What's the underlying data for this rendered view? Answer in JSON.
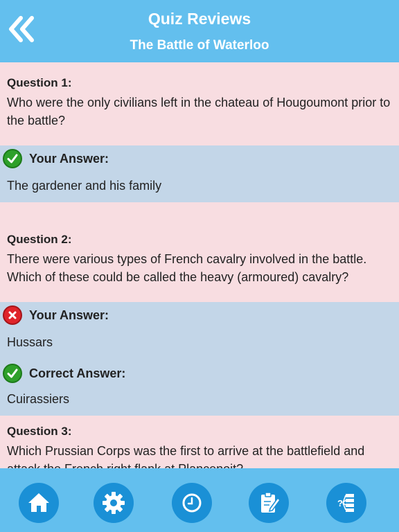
{
  "header": {
    "title": "Quiz Reviews",
    "subtitle": "The Battle of Waterloo"
  },
  "questions": [
    {
      "label": "Question 1:",
      "text": "Who were the only civilians left in the chateau of Hougoumont prior to the battle?",
      "your_answer_label": "Your Answer:",
      "your_answer": "The gardener and his family",
      "your_answer_status": "correct"
    },
    {
      "label": "Question 2:",
      "text": "There were various types of French cavalry involved in the battle. Which of these could be called the heavy (armoured) cavalry?",
      "your_answer_label": "Your Answer:",
      "your_answer": "Hussars",
      "your_answer_status": "wrong",
      "correct_answer_label": "Correct Answer:",
      "correct_answer": "Cuirassiers"
    },
    {
      "label": "Question 3:",
      "text": "Which Prussian Corps was the first to arrive at the battlefield and attack the French right flank at Plancenoit?"
    }
  ],
  "footer": {
    "icons": [
      "home-icon",
      "gear-icon",
      "clock-icon",
      "edit-note-icon",
      "quiz-list-icon"
    ]
  },
  "colors": {
    "header_bg": "#63bfee",
    "question_bg": "#f8dde1",
    "answer_bg": "#c3d6e8",
    "nav_button": "#1a90d6",
    "correct": "#2ea02a",
    "wrong": "#e0242a"
  }
}
